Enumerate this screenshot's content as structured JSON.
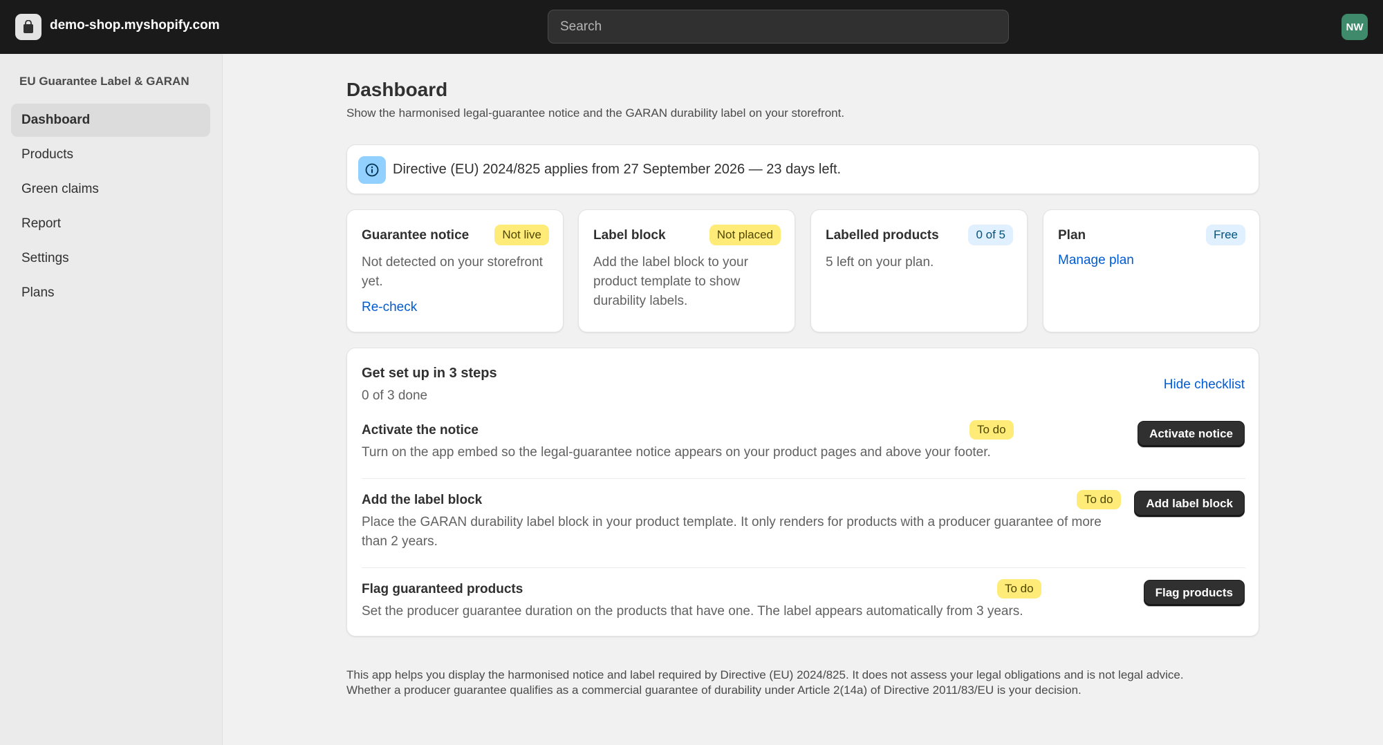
{
  "topbar": {
    "store_name": "demo-shop.myshopify.com",
    "search_placeholder": "Search",
    "avatar_initials": "NW"
  },
  "sidebar": {
    "app_name": "EU Guarantee Label & GARAN",
    "items": [
      {
        "label": "Dashboard",
        "active": true
      },
      {
        "label": "Products"
      },
      {
        "label": "Green claims"
      },
      {
        "label": "Report"
      },
      {
        "label": "Settings"
      },
      {
        "label": "Plans"
      }
    ]
  },
  "page": {
    "title": "Dashboard",
    "subtitle": "Show the harmonised legal-guarantee notice and the GARAN durability label on your storefront."
  },
  "banner": {
    "icon": "info-icon",
    "text": "Directive (EU) 2024/825 applies from 27 September 2026 — 23 days left."
  },
  "cards": [
    {
      "title": "Guarantee notice",
      "badge": "Not live",
      "text": "Not detected on your storefront yet.",
      "link": "Re-check"
    },
    {
      "title": "Label block",
      "badge": "Not placed",
      "text": "Add the label block to your product template to show durability labels."
    },
    {
      "title": "Labelled products",
      "badge": "0 of 5",
      "text": "5 left on your plan."
    },
    {
      "title": "Plan",
      "badge": "Free",
      "link": "Manage plan"
    }
  ],
  "checklist": {
    "title": "Get set up in 3 steps",
    "progress": "0 of 3 done",
    "hide_label": "Hide checklist",
    "steps": [
      {
        "title": "Activate the notice",
        "status": "To do",
        "text": "Turn on the app embed so the legal-guarantee notice appears on your product pages and above your footer.",
        "button": "Activate notice"
      },
      {
        "title": "Add the label block",
        "status": "To do",
        "text": "Place the GARAN durability label block in your product template. It only renders for products with a producer guarantee of more than 2 years.",
        "button": "Add label block"
      },
      {
        "title": "Flag guaranteed products",
        "status": "To do",
        "text": "Set the producer guarantee duration on the products that have one. The label appears automatically from 3 years.",
        "button": "Flag products"
      }
    ]
  },
  "footer": {
    "line1": "This app helps you display the harmonised notice and label required by Directive (EU) 2024/825. It does not assess your legal obligations and is not legal advice.",
    "line2": "Whether a producer guarantee qualifies as a commercial guarantee of durability under Article 2(14a) of Directive 2011/83/EU is your decision."
  },
  "colors": {
    "topbar": "#1a1a1a",
    "link": "#005bd3",
    "badge_warning": "#ffeb78",
    "badge_info": "#e0f0ff",
    "button_primary": "#303030",
    "avatar": "#3f8a6b"
  }
}
